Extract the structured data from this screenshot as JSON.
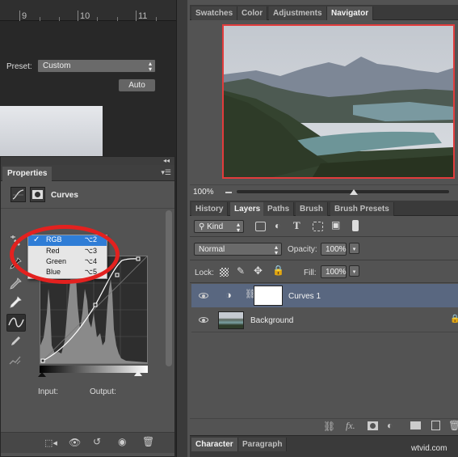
{
  "ruler": {
    "labels": [
      "9",
      "10",
      "11"
    ]
  },
  "properties": {
    "tab_label": "Properties",
    "adjustment_name": "Curves",
    "preset_label": "Preset:",
    "preset_value": "Custom",
    "auto_label": "Auto",
    "channel_dropdown": [
      {
        "label": "RGB",
        "shortcut": "⌥2",
        "selected": true
      },
      {
        "label": "Red",
        "shortcut": "⌥3",
        "selected": false
      },
      {
        "label": "Green",
        "shortcut": "⌥4",
        "selected": false
      },
      {
        "label": "Blue",
        "shortcut": "⌥5",
        "selected": false
      }
    ],
    "input_label": "Input:",
    "output_label": "Output:",
    "highlight_color": "#e3211f"
  },
  "top_tabs": [
    "Swatches",
    "Color",
    "Adjustments",
    "Navigator"
  ],
  "navigator": {
    "zoom": "100%",
    "zoom_slider_fraction": 0.55
  },
  "layers_tabs": [
    "History",
    "Layers",
    "Paths",
    "Brush",
    "Brush Presets"
  ],
  "layers": {
    "filter_kind": "Kind",
    "blend_mode": "Normal",
    "opacity_label": "Opacity:",
    "opacity_value": "100%",
    "lock_label": "Lock:",
    "fill_label": "Fill:",
    "fill_value": "100%",
    "rows": [
      {
        "name": "Curves 1",
        "selected": true
      },
      {
        "name": "Background",
        "selected": false
      }
    ]
  },
  "bottom_tabs": [
    "Character",
    "Paragraph"
  ],
  "watermark": "wtvid.com"
}
